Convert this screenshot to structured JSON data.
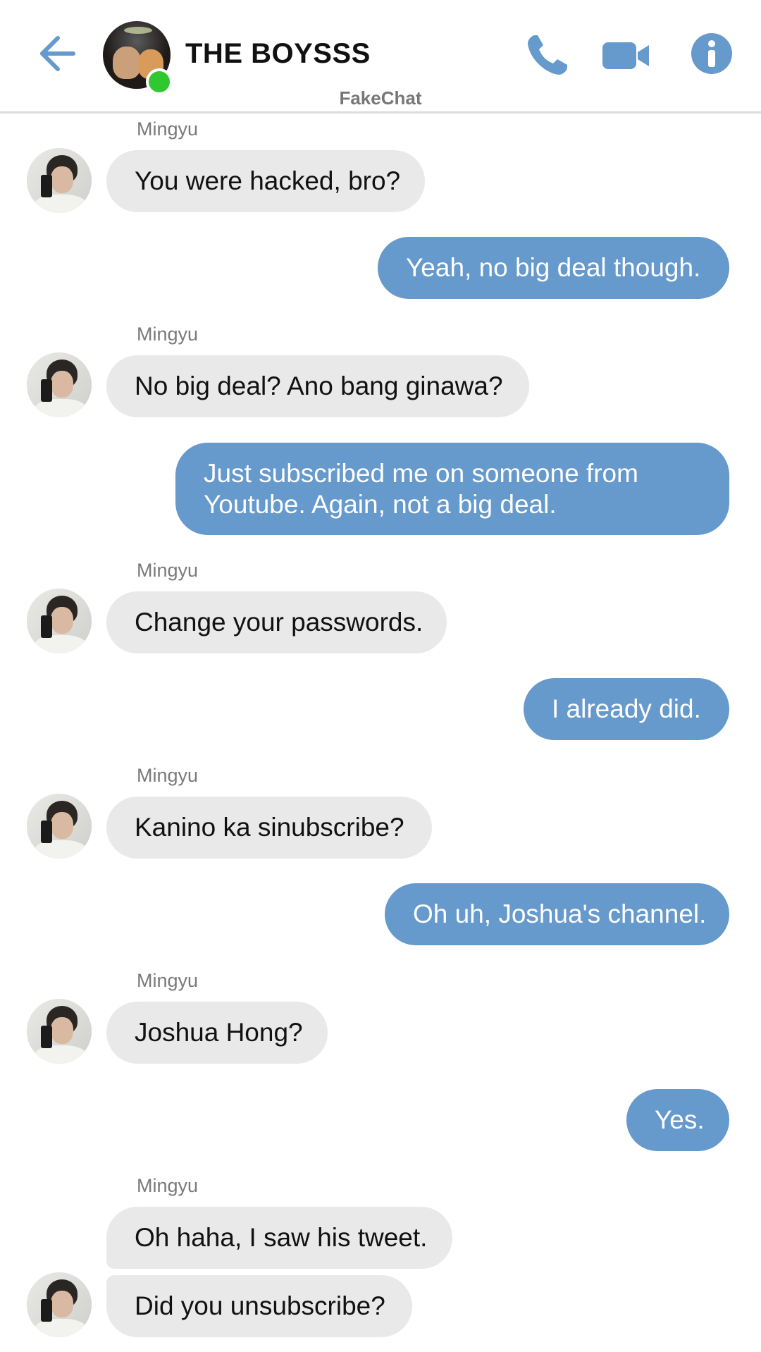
{
  "header": {
    "title": "THE BOYSSS",
    "back_icon": "arrow-left-icon",
    "phone_icon": "phone-icon",
    "video_icon": "video-camera-icon",
    "info_icon": "info-icon",
    "accent_color": "#6699cc",
    "online_color": "#2fc82f"
  },
  "watermark": "FakeChat",
  "messages": [
    {
      "sender": "Mingyu",
      "direction": "in",
      "text": "You were hacked, bro?"
    },
    {
      "direction": "out",
      "text": "Yeah, no big deal though."
    },
    {
      "sender": "Mingyu",
      "direction": "in",
      "text": "No big deal? Ano bang ginawa?"
    },
    {
      "direction": "out",
      "text": "Just subscribed me on someone from Youtube. Again, not a big deal."
    },
    {
      "sender": "Mingyu",
      "direction": "in",
      "text": "Change your passwords."
    },
    {
      "direction": "out",
      "text": "I already did."
    },
    {
      "sender": "Mingyu",
      "direction": "in",
      "text": "Kanino ka sinubscribe?"
    },
    {
      "direction": "out",
      "text": "Oh uh, Joshua's channel."
    },
    {
      "sender": "Mingyu",
      "direction": "in",
      "text": "Joshua Hong?"
    },
    {
      "direction": "out",
      "text": "Yes."
    },
    {
      "sender": "Mingyu",
      "direction": "in",
      "text": "Oh haha, I saw his tweet."
    },
    {
      "sender": "Mingyu",
      "direction": "in",
      "text": "Did you unsubscribe?"
    }
  ]
}
